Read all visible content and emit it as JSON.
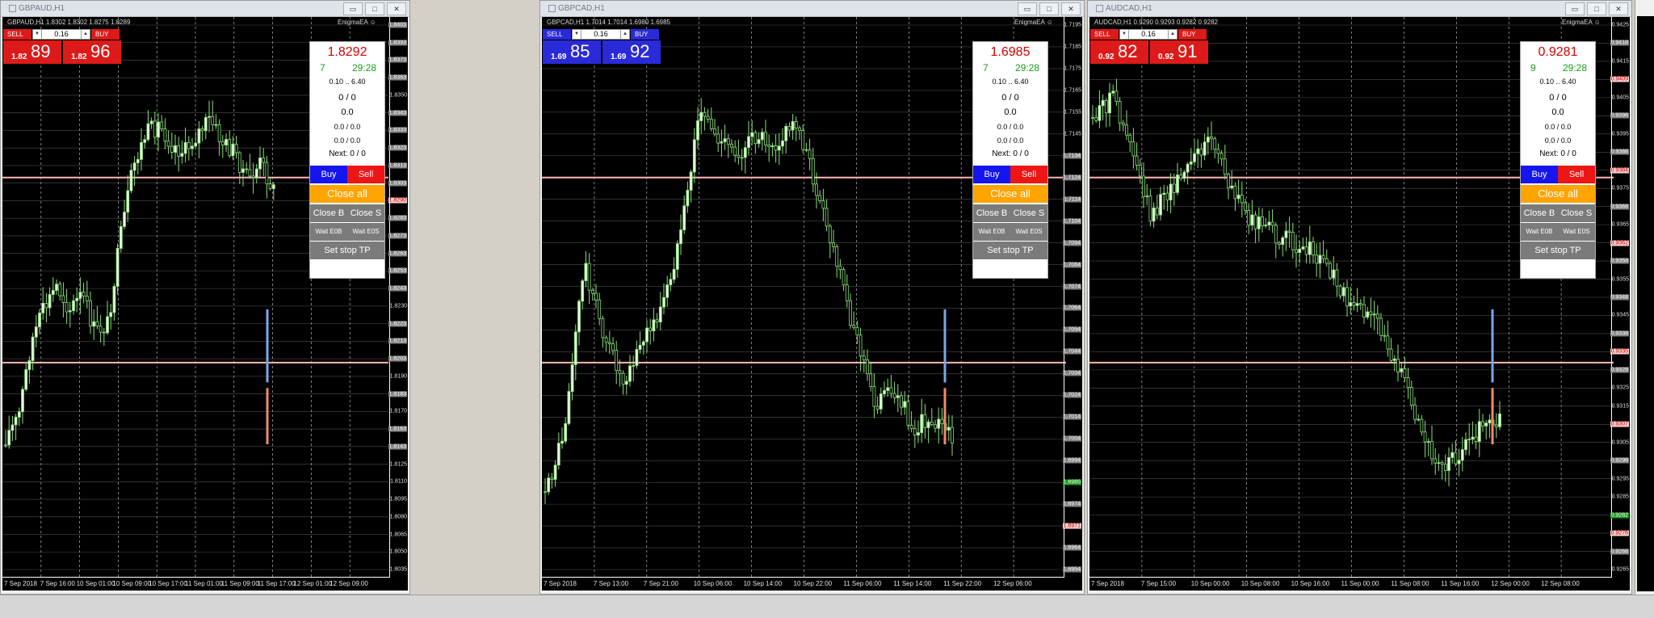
{
  "colors": {
    "bull": "#e8f8e0",
    "bear": "#8be07a",
    "grid": "#8a8a8a",
    "sell": "#dd1a1a",
    "buy_blue": "#2a2ad8",
    "orange": "#ffa400",
    "pink": "#ffb6b6"
  },
  "window_buttons": {
    "min": "▭",
    "max": "□",
    "close": "✕"
  },
  "status_bar": {
    "text": ""
  },
  "charts": [
    {
      "title": "GBPAUD,H1",
      "info": "GBPAUD,H1  1.8302 1.8302 1.8275 1.8289",
      "ea_label": "EnigmaEA ☺",
      "sell_label": "SELL",
      "buy_label": "BUY",
      "lot": "0.16",
      "sell_prefix": "1.82",
      "sell_big": "89",
      "buy_prefix": "1.82",
      "buy_big": "96",
      "buy_color": "#dd1a1a",
      "panel": {
        "price": "1.8292",
        "count": "7",
        "timer": "29:28",
        "range": "0.10 .. 6.40",
        "line1": "0 / 0",
        "line2": "0.0",
        "line3": "0.0 / 0.0",
        "line4": "0.0 / 0.0",
        "next": "Next: 0 / 0",
        "buy": "Buy",
        "sell": "Sell",
        "close_all": "Close all",
        "close_b": "Close B",
        "close_s": "Close S",
        "wait_b": "Wait E0B",
        "wait_s": "Wait E0S",
        "set_stop": "Set stop TP"
      },
      "yticks": [
        {
          "v": "1.8403",
          "s": "box"
        },
        {
          "v": "1.8393",
          "s": "box"
        },
        {
          "v": "1.8373",
          "s": "box"
        },
        {
          "v": "1.8363",
          "s": "box"
        },
        {
          "v": "1.8350",
          "s": ""
        },
        {
          "v": "1.8343",
          "s": "box"
        },
        {
          "v": "1.8333",
          "s": "box"
        },
        {
          "v": "1.8323",
          "s": "box"
        },
        {
          "v": "1.8313",
          "s": "box"
        },
        {
          "v": "1.8303",
          "s": "box"
        },
        {
          "v": "1.8290",
          "s": "red"
        },
        {
          "v": "1.8283",
          "s": "box"
        },
        {
          "v": "1.8273",
          "s": "box"
        },
        {
          "v": "1.8263",
          "s": "box"
        },
        {
          "v": "1.8253",
          "s": "box"
        },
        {
          "v": "1.8243",
          "s": "box"
        },
        {
          "v": "1.8230",
          "s": ""
        },
        {
          "v": "1.8223",
          "s": "box"
        },
        {
          "v": "1.8213",
          "s": "box"
        },
        {
          "v": "1.8203",
          "s": "box"
        },
        {
          "v": "1.8190",
          "s": ""
        },
        {
          "v": "1.8183",
          "s": "box"
        },
        {
          "v": "1.8170",
          "s": ""
        },
        {
          "v": "1.8163",
          "s": "box"
        },
        {
          "v": "1.8143",
          "s": "box"
        },
        {
          "v": "1.8125",
          "s": ""
        },
        {
          "v": "1.8110",
          "s": ""
        },
        {
          "v": "1.8095",
          "s": ""
        },
        {
          "v": "1.8080",
          "s": ""
        },
        {
          "v": "1.8065",
          "s": ""
        },
        {
          "v": "1.8050",
          "s": ""
        },
        {
          "v": "1.8035",
          "s": ""
        }
      ],
      "xticks": [
        "7 Sep 2018",
        "7 Sep 16:00",
        "10 Sep 01:00",
        "10 Sep 09:00",
        "10 Sep 17:00",
        "11 Sep 01:00",
        "11 Sep 09:00",
        "11 Sep 17:00",
        "12 Sep 01:00",
        "12 Sep 09:00"
      ]
    },
    {
      "title": "GBPCAD,H1",
      "info": "GBPCAD,H1  1.7014 1.7014 1.6980 1.6985",
      "ea_label": "EnigmaEA ☺",
      "sell_label": "SELL",
      "buy_label": "BUY",
      "lot": "0.16",
      "sell_prefix": "1.69",
      "sell_big": "85",
      "buy_prefix": "1.69",
      "buy_big": "92",
      "buy_color": "#2a2ad8",
      "panel": {
        "price": "1.6985",
        "count": "7",
        "timer": "29:28",
        "range": "0.10 .. 6.40",
        "line1": "0 / 0",
        "line2": "0.0",
        "line3": "0.0 / 0.0",
        "line4": "0.0 / 0.0",
        "next": "Next: 0 / 0",
        "buy": "Buy",
        "sell": "Sell",
        "close_all": "Close all",
        "close_b": "Close B",
        "close_s": "Close S",
        "wait_b": "Wait E0B",
        "wait_s": "Wait E0S",
        "set_stop": "Set stop TP"
      },
      "yticks": [
        {
          "v": "1.7195",
          "s": ""
        },
        {
          "v": "1.7185",
          "s": ""
        },
        {
          "v": "1.7175",
          "s": ""
        },
        {
          "v": "1.7165",
          "s": ""
        },
        {
          "v": "1.7155",
          "s": ""
        },
        {
          "v": "1.7145",
          "s": ""
        },
        {
          "v": "1.7134",
          "s": "box"
        },
        {
          "v": "1.7124",
          "s": "box"
        },
        {
          "v": "1.7114",
          "s": "box"
        },
        {
          "v": "1.7104",
          "s": "box"
        },
        {
          "v": "1.7094",
          "s": "box"
        },
        {
          "v": "1.7084",
          "s": "box"
        },
        {
          "v": "1.7074",
          "s": "box"
        },
        {
          "v": "1.7064",
          "s": "box"
        },
        {
          "v": "1.7054",
          "s": "box"
        },
        {
          "v": "1.7044",
          "s": "box"
        },
        {
          "v": "1.7034",
          "s": "box"
        },
        {
          "v": "1.7024",
          "s": "box"
        },
        {
          "v": "1.7014",
          "s": "box"
        },
        {
          "v": "1.7004",
          "s": "box"
        },
        {
          "v": "1.6994",
          "s": "box"
        },
        {
          "v": "1.6985",
          "s": "grn"
        },
        {
          "v": "1.6974",
          "s": "box"
        },
        {
          "v": "1.6971",
          "s": "red"
        },
        {
          "v": "1.6964",
          "s": "box"
        },
        {
          "v": "1.6954",
          "s": "box"
        }
      ],
      "xticks": [
        "7 Sep 2018",
        "7 Sep 13:00",
        "7 Sep 21:00",
        "10 Sep 06:00",
        "10 Sep 14:00",
        "10 Sep 22:00",
        "11 Sep 06:00",
        "11 Sep 14:00",
        "11 Sep 22:00",
        "12 Sep 06:00"
      ]
    },
    {
      "title": "AUDCAD,H1",
      "info": "AUDCAD,H1  0.9290 0.9293 0.9282 0.9282",
      "ea_label": "EnigmaEA ☺",
      "sell_label": "SELL",
      "buy_label": "BUY",
      "lot": "0.16",
      "sell_prefix": "0.92",
      "sell_big": "82",
      "buy_prefix": "0.92",
      "buy_big": "91",
      "buy_color": "#dd1a1a",
      "panel": {
        "price": "0.9281",
        "count": "9",
        "timer": "29:28",
        "range": "0.10 .. 6.40",
        "line1": "0 / 0",
        "line2": "0.0",
        "line3": "0.0 / 0.0",
        "line4": "0.0 / 0.0",
        "next": "Next: 0 / 0",
        "buy": "Buy",
        "sell": "Sell",
        "close_all": "Close all",
        "close_b": "Close B",
        "close_s": "Close S",
        "wait_b": "Wait E0B",
        "wait_s": "Wait E0S",
        "set_stop": "Set stop TP"
      },
      "yticks": [
        {
          "v": "0.9425",
          "s": ""
        },
        {
          "v": "0.9418",
          "s": "box"
        },
        {
          "v": "0.9415",
          "s": ""
        },
        {
          "v": "0.9409",
          "s": "red"
        },
        {
          "v": "0.9405",
          "s": ""
        },
        {
          "v": "0.9398",
          "s": "box"
        },
        {
          "v": "0.9395",
          "s": ""
        },
        {
          "v": "0.9388",
          "s": "box"
        },
        {
          "v": "0.9384",
          "s": "red"
        },
        {
          "v": "0.9375",
          "s": ""
        },
        {
          "v": "0.9368",
          "s": "box"
        },
        {
          "v": "0.9365",
          "s": ""
        },
        {
          "v": "0.9362",
          "s": "red"
        },
        {
          "v": "0.9358",
          "s": "box"
        },
        {
          "v": "0.9355",
          "s": ""
        },
        {
          "v": "0.9348",
          "s": "box"
        },
        {
          "v": "0.9345",
          "s": ""
        },
        {
          "v": "0.9338",
          "s": "box"
        },
        {
          "v": "0.9335",
          "s": "red"
        },
        {
          "v": "0.9328",
          "s": "box"
        },
        {
          "v": "0.9325",
          "s": ""
        },
        {
          "v": "0.9315",
          "s": ""
        },
        {
          "v": "0.9307",
          "s": "red"
        },
        {
          "v": "0.9305",
          "s": ""
        },
        {
          "v": "0.9298",
          "s": "box"
        },
        {
          "v": "0.9295",
          "s": ""
        },
        {
          "v": "0.9285",
          "s": ""
        },
        {
          "v": "0.9282",
          "s": "grn"
        },
        {
          "v": "0.9276",
          "s": "red"
        },
        {
          "v": "0.9268",
          "s": "box"
        },
        {
          "v": "0.9265",
          "s": ""
        }
      ],
      "xticks": [
        "7 Sep 2018",
        "7 Sep 15:00",
        "10 Sep 00:00",
        "10 Sep 08:00",
        "10 Sep 16:00",
        "11 Sep 00:00",
        "11 Sep 08:00",
        "11 Sep 16:00",
        "12 Sep 00:00",
        "12 Sep 08:00"
      ]
    }
  ]
}
